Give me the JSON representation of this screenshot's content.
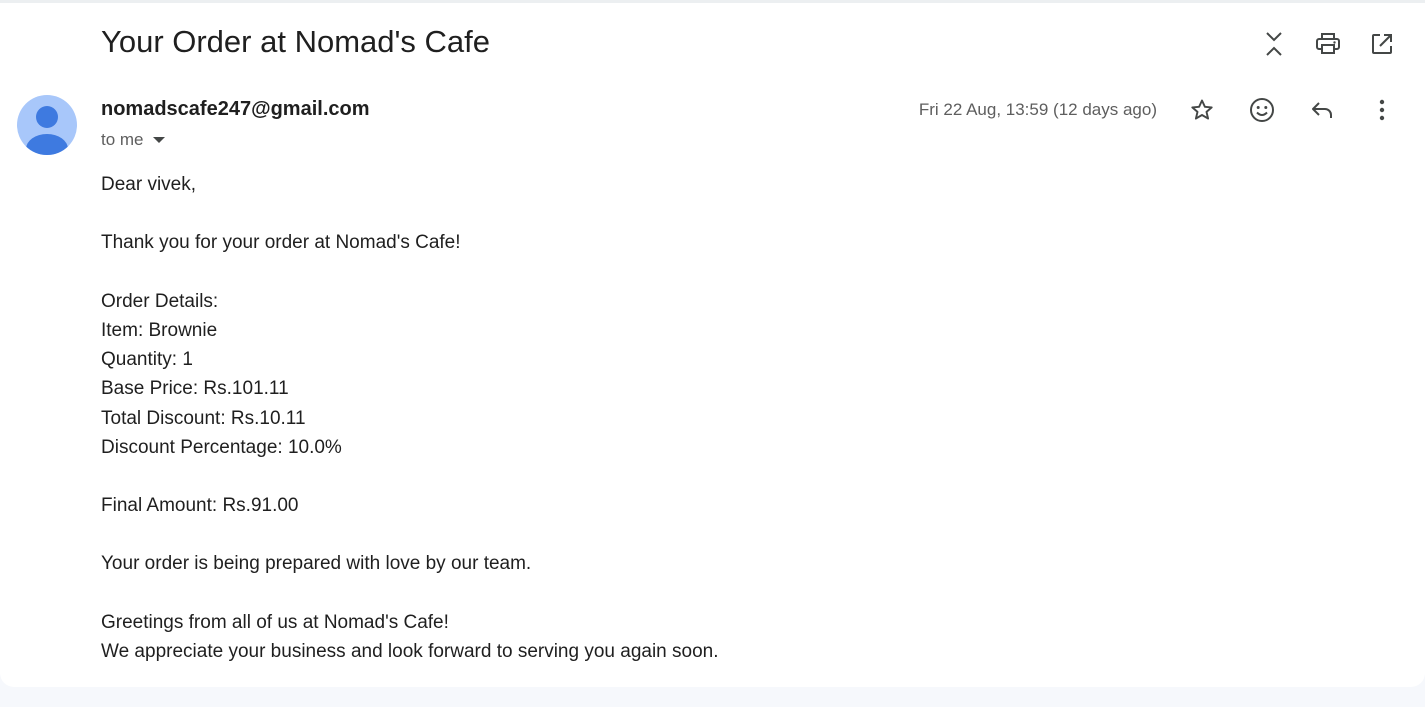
{
  "email": {
    "subject": "Your Order at Nomad's Cafe",
    "sender": "nomadscafe247@gmail.com",
    "recipient_label": "to me",
    "date": "Fri 22 Aug, 13:59 (12 days ago)",
    "body": {
      "greeting": "Dear vivek,",
      "thanks": "Thank you for your order at Nomad's Cafe!",
      "details_heading": "Order Details:",
      "item": "Item: Brownie",
      "quantity": "Quantity: 1",
      "base_price": "Base Price: Rs.101.11",
      "total_discount": "Total Discount: Rs.10.11",
      "discount_percentage": "Discount Percentage: 10.0%",
      "final_amount": "Final Amount: Rs.91.00",
      "prepared": "Your order is being prepared with love by our team.",
      "greetings": "Greetings from all of us at Nomad's Cafe!",
      "closing": "We appreciate your business and look forward to serving you again soon."
    }
  },
  "icons": {
    "collapse": "collapse-all-icon",
    "print": "print-icon",
    "open_new_window": "open-in-new-window-icon",
    "star": "star-icon",
    "emoji": "emoji-reaction-icon",
    "reply": "reply-icon",
    "more": "more-vertical-icon",
    "avatar": "person-avatar-icon"
  },
  "colors": {
    "avatar_background": "#a8c7fa",
    "avatar_figure": "#3e7ae0",
    "icon": "#444746",
    "page_background": "#f6f8fc"
  }
}
